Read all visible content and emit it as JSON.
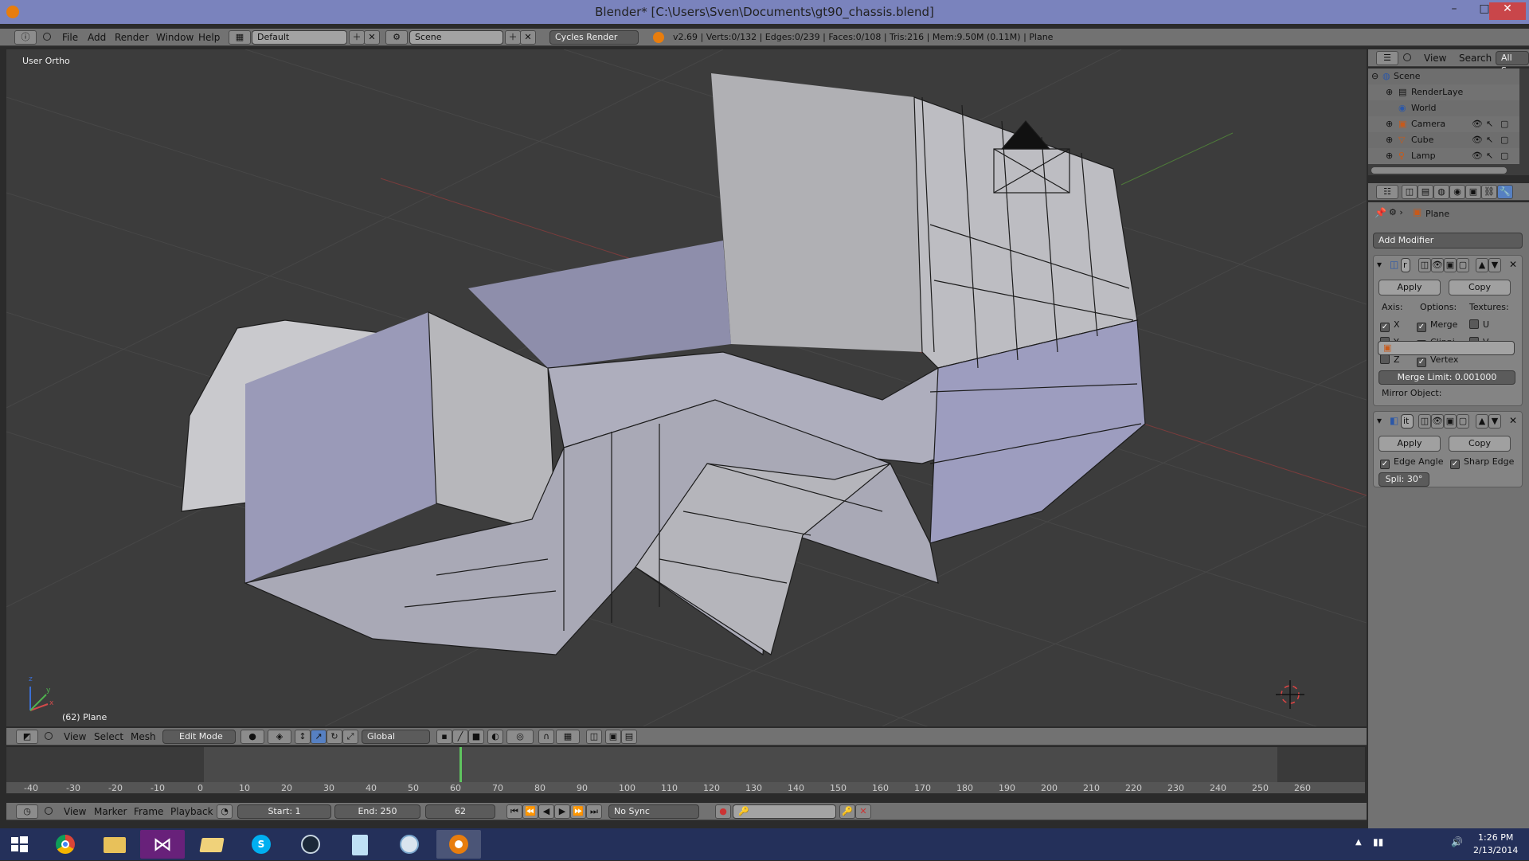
{
  "window": {
    "title": "Blender* [C:\\Users\\Sven\\Documents\\gt90_chassis.blend]",
    "minimize": "–",
    "maximize": "□",
    "close": "✕"
  },
  "top_menu": {
    "items": [
      "File",
      "Add",
      "Render",
      "Window",
      "Help"
    ],
    "layout_value": "Default",
    "scene_value": "Scene",
    "engine_value": "Cycles Render",
    "stats": "v2.69 | Verts:0/132 | Edges:0/239 | Faces:0/108 | Tris:216 | Mem:9.50M (0.11M) | Plane"
  },
  "viewport": {
    "view_label": "User Ortho",
    "object_label": "(62) Plane",
    "axis_x": "x",
    "axis_y": "y",
    "axis_z": "z"
  },
  "view3d_header": {
    "menus": [
      "View",
      "Select",
      "Mesh"
    ],
    "mode_value": "Edit Mode",
    "orientation_value": "Global"
  },
  "outliner": {
    "menus": [
      "View",
      "Search"
    ],
    "filter_value": "All Sc",
    "rows": [
      {
        "label": "Scene",
        "icon": "scene-icon"
      },
      {
        "label": "RenderLaye",
        "icon": "renderlayer-icon"
      },
      {
        "label": "World",
        "icon": "world-icon"
      },
      {
        "label": "Camera",
        "icon": "camera-icon"
      },
      {
        "label": "Cube",
        "icon": "mesh-icon"
      },
      {
        "label": "Lamp",
        "icon": "lamp-icon"
      }
    ]
  },
  "properties": {
    "context_object": "Plane",
    "add_modifier": "Add Modifier",
    "mirror": {
      "name_field": "r",
      "apply": "Apply",
      "copy": "Copy",
      "axis_label": "Axis:",
      "options_label": "Options:",
      "textures_label": "Textures:",
      "x": "X",
      "y": "Y",
      "z": "Z",
      "merge": "Merge",
      "clipping": "Clippi",
      "vertex": "Vertex",
      "u": "U",
      "v": "V",
      "merge_limit": "Merge Limit: 0.001000",
      "mirror_object_label": "Mirror Object:",
      "x_checked": true,
      "y_checked": false,
      "z_checked": false,
      "merge_checked": true,
      "clipping_checked": true,
      "vertex_checked": true,
      "u_checked": false,
      "v_checked": false
    },
    "edge_split": {
      "name_field": "it",
      "apply": "Apply",
      "copy": "Copy",
      "edge_angle": "Edge Angle",
      "sharp_edge": "Sharp Edge",
      "split_angle": "Spli: 30°",
      "edge_angle_checked": true,
      "sharp_edge_checked": true
    }
  },
  "timeline": {
    "ruler": [
      "-40",
      "-30",
      "-20",
      "-10",
      "0",
      "10",
      "20",
      "30",
      "40",
      "50",
      "60",
      "70",
      "80",
      "90",
      "100",
      "110",
      "120",
      "130",
      "140",
      "150",
      "160",
      "170",
      "180",
      "190",
      "200",
      "210",
      "220",
      "230",
      "240",
      "250",
      "260"
    ],
    "current_frame_fraction": 0.3333,
    "menus": [
      "View",
      "Marker",
      "Frame",
      "Playback"
    ],
    "start": "Start: 1",
    "end": "End: 250",
    "current": "62",
    "sync": "No Sync"
  },
  "taskbar": {
    "time": "1:26 PM",
    "date": "2/13/2014",
    "apps": [
      "start-icon",
      "chrome-icon",
      "explorer-icon",
      "visual-studio-icon",
      "folder-icon",
      "skype-icon",
      "steam-icon",
      "notepad-icon",
      "paint-icon",
      "blender-icon"
    ]
  }
}
